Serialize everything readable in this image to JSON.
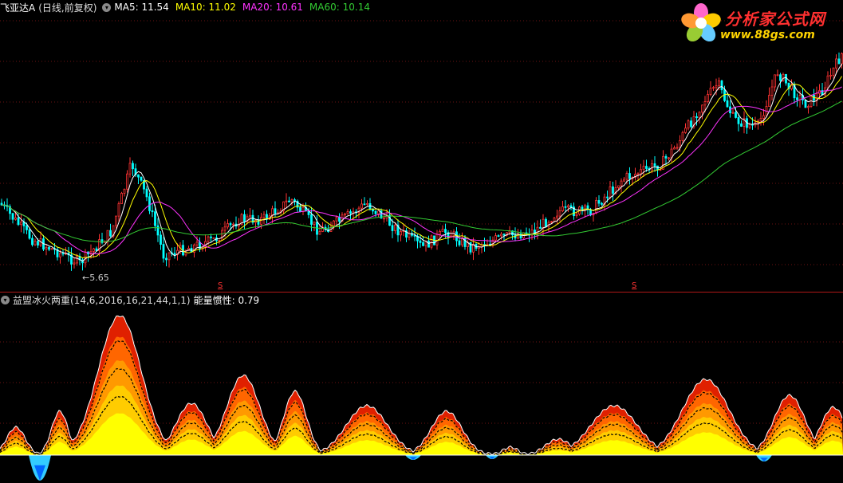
{
  "price_panel": {
    "stock_name": "飞亚达A",
    "period_label": "(日线,前复权)",
    "ma": [
      {
        "label": "MA5: 11.54",
        "color": "#ffffff"
      },
      {
        "label": "MA10: 11.02",
        "color": "#ffff00"
      },
      {
        "label": "MA20: 10.61",
        "color": "#ff33ff"
      },
      {
        "label": "MA60: 10.14",
        "color": "#33cc33"
      }
    ],
    "low_marker": "←5.65",
    "signal_marks": [
      "S",
      "S"
    ],
    "colors": {
      "up": "#ff3333",
      "down": "#00ffff",
      "grid": "#6b1212",
      "bg": "#000000"
    }
  },
  "indicator_panel": {
    "name": "益盟冰火两重(14,6,2016,16,21,44,1,1)",
    "value_label": "能量惯性: 0.79",
    "value_color": "#ffffff",
    "fire_colors": [
      "#ffff00",
      "#ffcc00",
      "#ff9900",
      "#ff6600",
      "#e02000",
      "#ffffff"
    ],
    "ice_colors": [
      "#33ccff",
      "#0066ff"
    ]
  },
  "watermark": {
    "title": "分析家公式网",
    "url": "www.88gs.com",
    "flower_colors": [
      "#ff66cc",
      "#ffcc00",
      "#66ccff",
      "#99cc33",
      "#ff9933"
    ]
  }
}
